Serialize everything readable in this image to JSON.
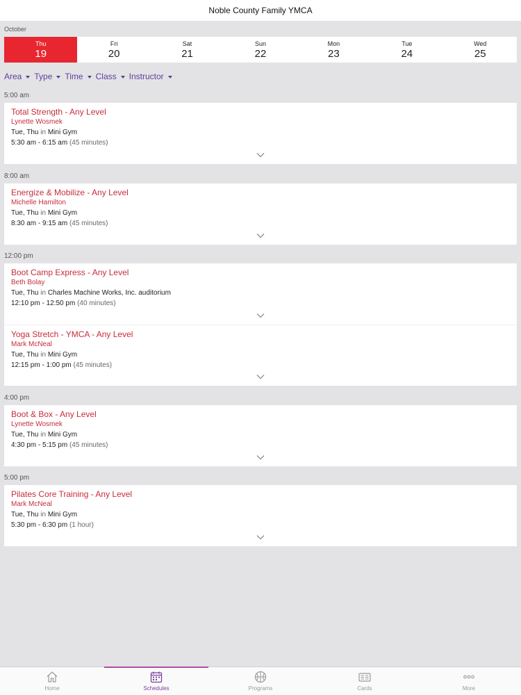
{
  "header": {
    "title": "Noble County Family YMCA"
  },
  "calendar": {
    "month": "October",
    "days": [
      {
        "name": "Thu",
        "num": "19",
        "selected": true
      },
      {
        "name": "Fri",
        "num": "20"
      },
      {
        "name": "Sat",
        "num": "21"
      },
      {
        "name": "Sun",
        "num": "22"
      },
      {
        "name": "Mon",
        "num": "23"
      },
      {
        "name": "Tue",
        "num": "24"
      },
      {
        "name": "Wed",
        "num": "25"
      }
    ]
  },
  "filters": [
    "Area",
    "Type",
    "Time",
    "Class",
    "Instructor"
  ],
  "groups": [
    {
      "time": "5:00 am",
      "classes": [
        {
          "title": "Total Strength - Any Level",
          "instructor": "Lynette Wosmek",
          "days": "Tue, Thu",
          "in_word": "in",
          "location": "Mini Gym",
          "range": "5:30 am - 6:15 am",
          "duration": "(45 minutes)"
        }
      ]
    },
    {
      "time": "8:00 am",
      "classes": [
        {
          "title": "Energize & Mobilize - Any Level",
          "instructor": "Michelle Hamilton",
          "days": "Tue, Thu",
          "in_word": "in",
          "location": "Mini Gym",
          "range": "8:30 am - 9:15 am",
          "duration": "(45 minutes)"
        }
      ]
    },
    {
      "time": "12:00 pm",
      "classes": [
        {
          "title": "Boot Camp Express - Any Level",
          "instructor": "Beth Bolay",
          "days": "Tue, Thu",
          "in_word": "in",
          "location": "Charles Machine Works, Inc. auditorium",
          "range": "12:10 pm - 12:50 pm",
          "duration": "(40 minutes)"
        },
        {
          "title": "Yoga Stretch - YMCA - Any Level",
          "instructor": "Mark McNeal",
          "days": "Tue, Thu",
          "in_word": "in",
          "location": "Mini Gym",
          "range": "12:15 pm - 1:00 pm",
          "duration": "(45 minutes)"
        }
      ]
    },
    {
      "time": "4:00 pm",
      "classes": [
        {
          "title": "Boot & Box - Any Level",
          "instructor": "Lynette Wosmek",
          "days": "Tue, Thu",
          "in_word": "in",
          "location": "Mini Gym",
          "range": "4:30 pm - 5:15 pm",
          "duration": "(45 minutes)"
        }
      ]
    },
    {
      "time": "5:00 pm",
      "classes": [
        {
          "title": "Pilates Core Training - Any Level",
          "instructor": "Mark McNeal",
          "days": "Tue, Thu",
          "in_word": "in",
          "location": "Mini Gym",
          "range": "5:30 pm - 6:30 pm",
          "duration": "(1 hour)"
        }
      ]
    }
  ],
  "tabs": [
    {
      "label": "Home",
      "icon": "home-icon"
    },
    {
      "label": "Schedules",
      "icon": "calendar-icon",
      "active": true
    },
    {
      "label": "Programs",
      "icon": "basketball-icon"
    },
    {
      "label": "Cards",
      "icon": "card-icon"
    },
    {
      "label": "More",
      "icon": "more-icon"
    }
  ],
  "colors": {
    "accent_red": "#e8262f",
    "class_title": "#c72c3b",
    "filter_purple": "#5b3e9b",
    "active_tab": "#7a3e9e"
  }
}
